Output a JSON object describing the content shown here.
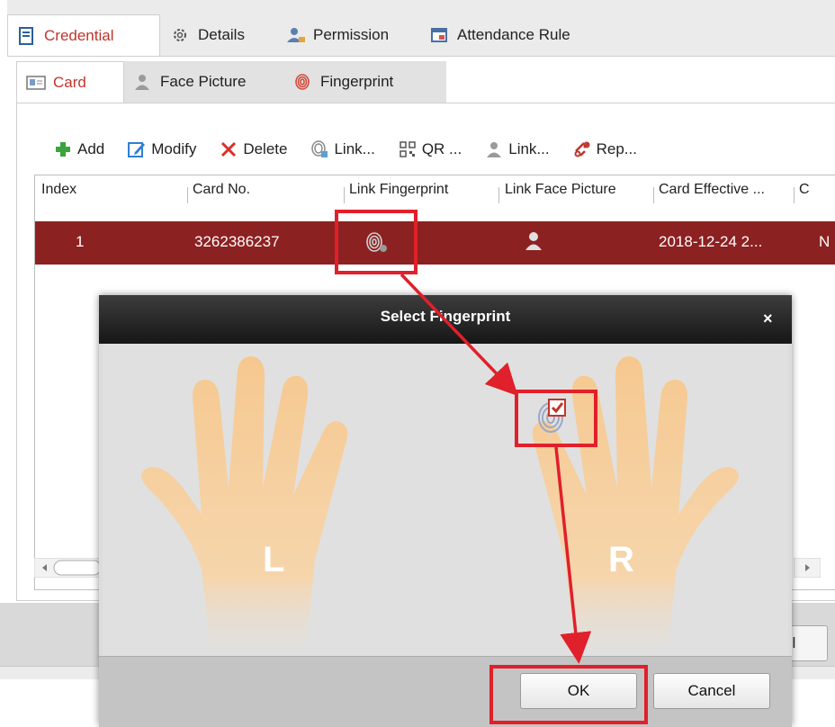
{
  "main_tabs": [
    "Credential",
    "Details",
    "Permission",
    "Attendance Rule"
  ],
  "sub_tabs": [
    "Card",
    "Face Picture",
    "Fingerprint"
  ],
  "toolbar": {
    "add": "Add",
    "modify": "Modify",
    "delete": "Delete",
    "link_fp": "Link...",
    "qr": "QR ...",
    "link_face": "Link...",
    "replace": "Rep..."
  },
  "table": {
    "headers": [
      "Index",
      "Card No.",
      "Link Fingerprint",
      "Link Face Picture",
      "Card Effective ...",
      "C"
    ],
    "rows": [
      {
        "index": "1",
        "card_no": "3262386237",
        "card_effective": "2018-12-24 2...",
        "extra": "N"
      }
    ]
  },
  "background_button": "el",
  "dialog": {
    "title": "Select Fingerprint",
    "close": "×",
    "left_hand": "L",
    "right_hand": "R",
    "ok": "OK",
    "cancel": "Cancel"
  },
  "colors": {
    "accent": "#c0352c",
    "selected_row": "#8c2121",
    "annotation_red": "#e0202a",
    "hand": "#f6c88f"
  }
}
